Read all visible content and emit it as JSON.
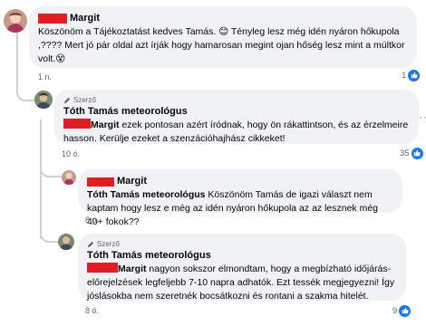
{
  "comments": [
    {
      "author": "Margit",
      "text": "Köszönöm a Tájékoztatást kedves Tamás. 😊 Tényleg lesz még idén nyáron hőkupola ,???? Mert jó pár oldal azt írják hogy hamarosan megint ojan hőség lesz mint a múltkor volt.😵",
      "time": "1 n.",
      "reactions": "1"
    },
    {
      "author": "Tóth Tamás meteorológus",
      "badge": "Szerző",
      "mention": "Margit",
      "text": " ezek pontosan azért íródnak, hogy ön rákattintson, és az érzelmeire hasson. Kerülje ezeket a szenzációhajhász cikkeket!",
      "time": "10 ó.",
      "reactions": "35",
      "more": "···"
    },
    {
      "author": "Margit",
      "mention": "Tóth Tamás meteorológus",
      "text": " Köszönöm Tamás de igazi választ nem kaptam hogy lesz e még az idén nyáron hőkupola az az lesznek még 40+ fokok??",
      "time": "8 ó."
    },
    {
      "author": "Tóth Tamás meteorológus",
      "badge": "Szerző",
      "mention": "Margit",
      "text": " nagyon sokszor elmondtam, hogy a megbízható időjárás-előrejelzések legfeljebb 7-10 napra adhatók. Ezt tessék megjegyezni! Így jóslásokba nem szeretnék bocsátkozni és rontani a szakma hitelét.",
      "time": "8 ó.",
      "reactions": "9"
    }
  ],
  "colors": {
    "like": "#1877f2",
    "redaction": "#e31b23",
    "bubble": "#f0f2f5",
    "meta": "#65676b"
  }
}
